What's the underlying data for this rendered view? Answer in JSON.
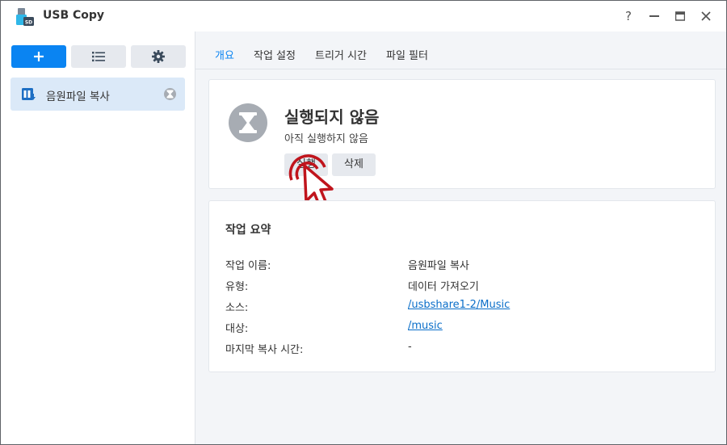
{
  "window": {
    "title": "USB Copy",
    "help_label": "?"
  },
  "sidebar": {
    "tasks": [
      {
        "label": "음원파일 복사",
        "status_icon": "hourglass-icon"
      }
    ]
  },
  "tabs": [
    {
      "label": "개요",
      "active": true
    },
    {
      "label": "작업 설정",
      "active": false
    },
    {
      "label": "트리거 시간",
      "active": false
    },
    {
      "label": "파일 필터",
      "active": false
    }
  ],
  "status": {
    "title": "실행되지 않음",
    "subtitle": "아직 실행하지 않음",
    "run_label": "실행",
    "delete_label": "삭제"
  },
  "summary": {
    "title": "작업 요약",
    "rows": [
      {
        "label": "작업 이름:",
        "value": "음원파일 복사",
        "link": false
      },
      {
        "label": "유형:",
        "value": "데이터 가져오기",
        "link": false
      },
      {
        "label": "소스:",
        "value": "/usbshare1-2/Music",
        "link": true
      },
      {
        "label": "대상:",
        "value": "/music",
        "link": true
      },
      {
        "label": "마지막 복사 시간:",
        "value": "-",
        "link": false
      }
    ]
  },
  "colors": {
    "accent": "#0a84f2",
    "selected_bg": "#dbe9f8",
    "annotation": "#c0141c"
  }
}
